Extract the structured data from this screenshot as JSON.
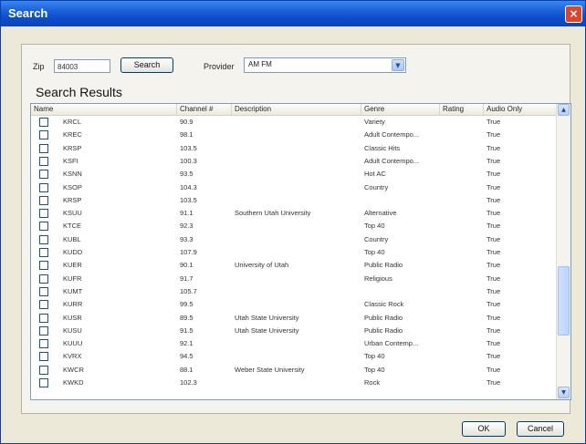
{
  "window": {
    "title": "Search",
    "close_glyph": "×"
  },
  "search": {
    "zip_label": "Zip",
    "zip_value": "84003",
    "search_button": "Search",
    "provider_label": "Provider",
    "provider_value": "AM FM"
  },
  "results": {
    "title": "Search Results",
    "columns": [
      "Name",
      "Channel #",
      "Description",
      "Genre",
      "Rating",
      "Audio Only"
    ],
    "rows": [
      {
        "name": "KRCL",
        "channel": "90.9",
        "description": "",
        "genre": "Variety",
        "rating": "",
        "audio": "True"
      },
      {
        "name": "KREC",
        "channel": "98.1",
        "description": "",
        "genre": "Adult Contempo...",
        "rating": "",
        "audio": "True"
      },
      {
        "name": "KRSP",
        "channel": "103.5",
        "description": "",
        "genre": "Classic Hits",
        "rating": "",
        "audio": "True"
      },
      {
        "name": "KSFI",
        "channel": "100.3",
        "description": "",
        "genre": "Adult Contempo...",
        "rating": "",
        "audio": "True"
      },
      {
        "name": "KSNN",
        "channel": "93.5",
        "description": "",
        "genre": "Hot AC",
        "rating": "",
        "audio": "True"
      },
      {
        "name": "KSOP",
        "channel": "104.3",
        "description": "",
        "genre": "Country",
        "rating": "",
        "audio": "True"
      },
      {
        "name": "KRSP",
        "channel": "103.5",
        "description": "",
        "genre": "",
        "rating": "",
        "audio": "True"
      },
      {
        "name": "KSUU",
        "channel": "91.1",
        "description": "Southern Utah University",
        "genre": "Alternative",
        "rating": "",
        "audio": "True"
      },
      {
        "name": "KTCE",
        "channel": "92.3",
        "description": "",
        "genre": "Top 40",
        "rating": "",
        "audio": "True"
      },
      {
        "name": "KUBL",
        "channel": "93.3",
        "description": "",
        "genre": "Country",
        "rating": "",
        "audio": "True"
      },
      {
        "name": "KUDD",
        "channel": "107.9",
        "description": "",
        "genre": "Top 40",
        "rating": "",
        "audio": "True"
      },
      {
        "name": "KUER",
        "channel": "90.1",
        "description": "University of Utah",
        "genre": "Public Radio",
        "rating": "",
        "audio": "True"
      },
      {
        "name": "KUFR",
        "channel": "91.7",
        "description": "",
        "genre": "Religious",
        "rating": "",
        "audio": "True"
      },
      {
        "name": "KUMT",
        "channel": "105.7",
        "description": "",
        "genre": "",
        "rating": "",
        "audio": "True"
      },
      {
        "name": "KURR",
        "channel": "99.5",
        "description": "",
        "genre": "Classic Rock",
        "rating": "",
        "audio": "True"
      },
      {
        "name": "KUSR",
        "channel": "89.5",
        "description": "Utah State University",
        "genre": "Public Radio",
        "rating": "",
        "audio": "True"
      },
      {
        "name": "KUSU",
        "channel": "91.5",
        "description": "Utah State University",
        "genre": "Public Radio",
        "rating": "",
        "audio": "True"
      },
      {
        "name": "KUUU",
        "channel": "92.1",
        "description": "",
        "genre": "Urban Contemp...",
        "rating": "",
        "audio": "True"
      },
      {
        "name": "KVRX",
        "channel": "94.5",
        "description": "",
        "genre": "Top 40",
        "rating": "",
        "audio": "True"
      },
      {
        "name": "KWCR",
        "channel": "88.1",
        "description": "Weber State University",
        "genre": "Top 40",
        "rating": "",
        "audio": "True"
      },
      {
        "name": "KWKD",
        "channel": "102.3",
        "description": "",
        "genre": "Rock",
        "rating": "",
        "audio": "True"
      }
    ]
  },
  "icons": {
    "scroll_up": "up-arrow-icon",
    "scroll_down": "down-arrow-icon",
    "dropdown": "chevron-down-icon"
  },
  "buttons": {
    "ok": "OK",
    "cancel": "Cancel"
  },
  "colors": {
    "titlebar": "#0b45bd",
    "dialog_bg": "#ece9d8",
    "grid_bg": "#ffffff",
    "border_blue": "#7f9db9"
  }
}
